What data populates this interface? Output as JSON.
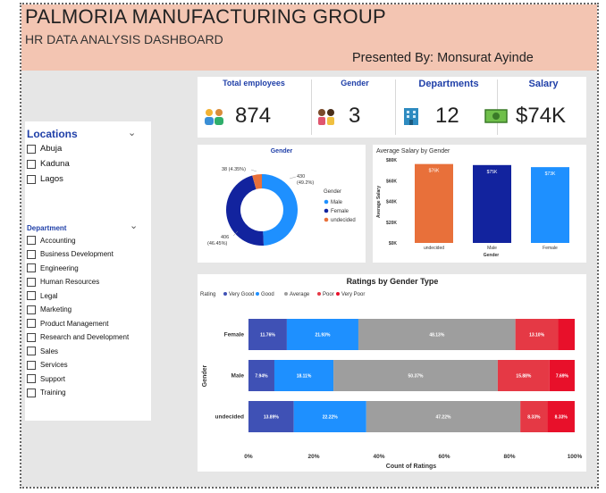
{
  "header": {
    "title": "PALMORIA MANUFACTURING GROUP",
    "subtitle": "HR DATA ANALYSIS DASHBOARD",
    "presenter": "Presented By: Monsurat Ayinde"
  },
  "locations": {
    "title": "Locations",
    "items": [
      "Abuja",
      "Kaduna",
      "Lagos"
    ]
  },
  "department": {
    "title": "Department",
    "items": [
      "Accounting",
      "Business Development",
      "Engineering",
      "Human Resources",
      "Legal",
      "Marketing",
      "Product Management",
      "Research and Development",
      "Sales",
      "Services",
      "Support",
      "Training"
    ]
  },
  "kpis": {
    "total_employees": {
      "label": "Total employees",
      "value": "874",
      "icon": "people-icon"
    },
    "gender": {
      "label": "Gender",
      "value": "3",
      "icon": "gender-icon"
    },
    "departments": {
      "label": "Departments",
      "value": "12",
      "icon": "building-icon"
    },
    "salary": {
      "label": "Salary",
      "value": "$74K",
      "icon": "money-icon"
    }
  },
  "colors": {
    "male": "#1e90ff",
    "female": "#12239e",
    "undecided": "#e8703a",
    "very_good": "#3f51b5",
    "good": "#1e90ff",
    "average": "#9e9e9e",
    "poor": "#e53945",
    "very_poor": "#e8102a"
  },
  "chart_data": [
    {
      "type": "pie",
      "title": "Gender",
      "legend_title": "Gender",
      "legend_placement": "right",
      "slices": [
        {
          "name": "Male",
          "value": 430,
          "label": "430",
          "pct_label": "(49.2%)"
        },
        {
          "name": "Female",
          "value": 406,
          "label": "406",
          "pct_label": "(46.45%)"
        },
        {
          "name": "undecided",
          "value": 38,
          "label": "38 (4.35%)",
          "pct_label": ""
        }
      ]
    },
    {
      "type": "bar",
      "title": "Average Salary by Gender",
      "xlabel": "Gender",
      "ylabel": "Average Salary",
      "categories": [
        "undecided",
        "Male",
        "Female"
      ],
      "values": [
        76,
        75,
        73
      ],
      "data_labels": [
        "$76K",
        "$75K",
        "$73K"
      ],
      "yticks": [
        "$80K",
        "$60K",
        "$40K",
        "$20K",
        "$0K"
      ],
      "ytick_values": [
        80,
        60,
        40,
        20,
        0
      ],
      "ylim": [
        0,
        80
      ]
    },
    {
      "type": "bar",
      "orientation": "horizontal-stacked-100",
      "title": "Ratings by Gender Type",
      "legend_title": "Rating",
      "legend_placement": "top-left",
      "xlabel": "Count of Ratings",
      "ylabel": "Gender",
      "xticks": [
        "0%",
        "20%",
        "40%",
        "60%",
        "80%",
        "100%"
      ],
      "categories": [
        "Female",
        "Male",
        "undecided"
      ],
      "series": [
        {
          "name": "Very Good",
          "values": [
            11.76,
            7.94,
            13.89
          ],
          "labels": [
            "11.76%",
            "7.94%",
            "13.89%"
          ]
        },
        {
          "name": "Good",
          "values": [
            21.93,
            18.11,
            22.22
          ],
          "labels": [
            "21.93%",
            "18.11%",
            "22.22%"
          ]
        },
        {
          "name": "Average",
          "values": [
            48.13,
            50.37,
            47.22
          ],
          "labels": [
            "48.13%",
            "50.37%",
            "47.22%"
          ]
        },
        {
          "name": "Poor",
          "values": [
            13.1,
            15.88,
            8.33
          ],
          "labels": [
            "13.10%",
            "15.88%",
            "8.33%"
          ]
        },
        {
          "name": "Very Poor",
          "values": [
            5.08,
            7.69,
            8.33
          ],
          "labels": [
            "",
            "7.69%",
            "8.33%"
          ]
        }
      ]
    }
  ]
}
